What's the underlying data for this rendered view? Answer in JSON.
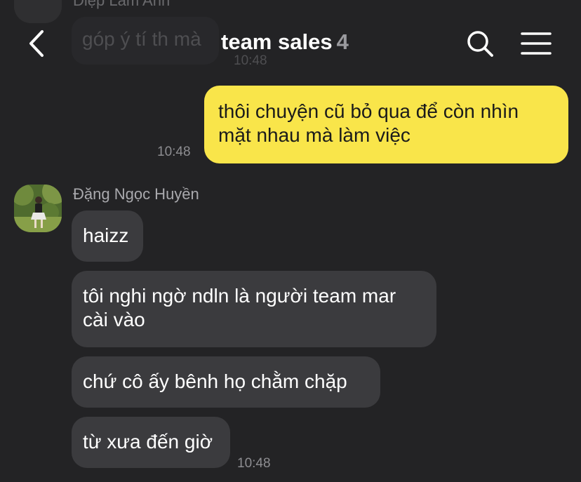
{
  "background_previous": {
    "sender": "Diệp Lam Anh",
    "message": "góp ý tí th mà",
    "time": "10:48"
  },
  "header": {
    "title": "team sales",
    "member_count": "4",
    "back_icon": "chevron-left-icon",
    "search_icon": "search-icon",
    "menu_icon": "menu-icon"
  },
  "messages": {
    "outgoing": {
      "lines": [
        "thôi chuyện cũ bỏ qua để còn nhìn",
        "mặt nhau mà làm việc"
      ],
      "time": "10:48"
    },
    "incoming": {
      "sender": "Đặng Ngọc Huyền",
      "bubbles": [
        {
          "lines": [
            "haizz"
          ]
        },
        {
          "lines": [
            "tôi nghi ngờ ndln là người team mar",
            "cài vào"
          ]
        },
        {
          "lines": [
            "chứ cô ấy bênh họ chằm chặp"
          ]
        },
        {
          "lines": [
            "từ xưa đến giờ"
          ]
        }
      ],
      "time": "10:48"
    }
  },
  "colors": {
    "background": "#232325",
    "outgoing_bubble": "#f9e54a",
    "incoming_bubble": "#3b3b3e",
    "timestamp": "#8d8d91"
  }
}
